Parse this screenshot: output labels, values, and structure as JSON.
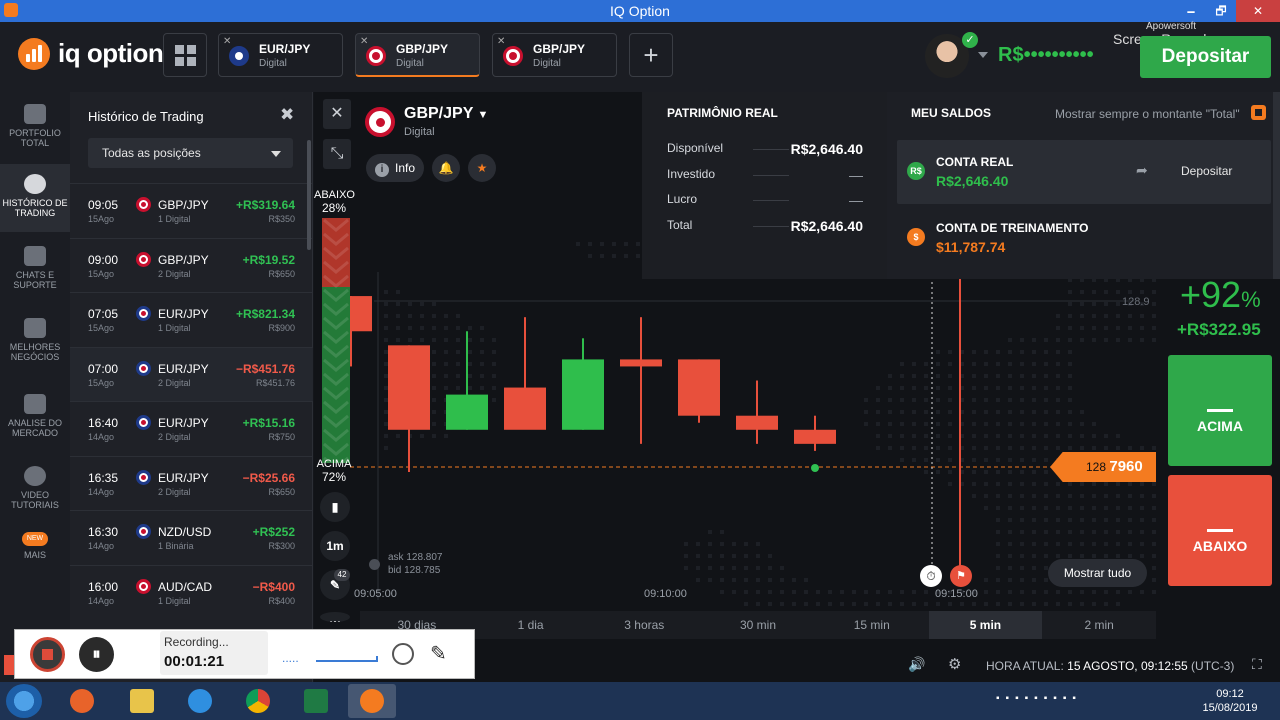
{
  "window": {
    "title": "IQ Option",
    "min": "🗕",
    "max": "🗗",
    "close": "✕"
  },
  "header": {
    "logo": "iq option",
    "tabs": [
      {
        "name": "EUR/JPY",
        "sub": "Digital"
      },
      {
        "name": "GBP/JPY",
        "sub": "Digital"
      },
      {
        "name": "GBP/JPY",
        "sub": "Digital"
      }
    ],
    "add_tab": "+",
    "balance": "R$••••••••••",
    "recorder_watermark_1": "Apowersoft",
    "recorder_watermark_2": "Screen Recorder",
    "deposit_label": "Depositar"
  },
  "sidebar": {
    "items": [
      {
        "label": "PORTFOLIO TOTAL"
      },
      {
        "label": "HISTÓRICO DE TRADING"
      },
      {
        "label": "CHATS E SUPORTE"
      },
      {
        "label": "MELHORES NEGÓCIOS"
      },
      {
        "label": "ANALISE DO MERCADO"
      },
      {
        "label": "VIDEO TUTORIAIS"
      },
      {
        "label": "MAIS",
        "badge": "NEW"
      }
    ]
  },
  "history": {
    "title": "Histórico de Trading",
    "close": "✖",
    "filter": "Todas as posições",
    "rows": [
      {
        "time": "09:05",
        "date": "15Ago",
        "pair": "GBP/JPY",
        "kind": "1 Digital",
        "amount": "+R$319.64",
        "invest": "R$350",
        "sign": "pos",
        "flag": "gb"
      },
      {
        "time": "09:00",
        "date": "15Ago",
        "pair": "GBP/JPY",
        "kind": "2 Digital",
        "amount": "+R$19.52",
        "invest": "R$650",
        "sign": "pos",
        "flag": "gb"
      },
      {
        "time": "07:05",
        "date": "15Ago",
        "pair": "EUR/JPY",
        "kind": "1 Digital",
        "amount": "+R$821.34",
        "invest": "R$900",
        "sign": "pos",
        "flag": "eu"
      },
      {
        "time": "07:00",
        "date": "15Ago",
        "pair": "EUR/JPY",
        "kind": "2 Digital",
        "amount": "−R$451.76",
        "invest": "R$451.76",
        "sign": "neg",
        "flag": "eu"
      },
      {
        "time": "16:40",
        "date": "14Ago",
        "pair": "EUR/JPY",
        "kind": "2 Digital",
        "amount": "+R$15.16",
        "invest": "R$750",
        "sign": "pos",
        "flag": "eu"
      },
      {
        "time": "16:35",
        "date": "14Ago",
        "pair": "EUR/JPY",
        "kind": "2 Digital",
        "amount": "−R$25.66",
        "invest": "R$650",
        "sign": "neg",
        "flag": "eu"
      },
      {
        "time": "16:30",
        "date": "14Ago",
        "pair": "NZD/USD",
        "kind": "1 Binária",
        "amount": "+R$252",
        "invest": "R$300",
        "sign": "pos",
        "flag": "eu"
      },
      {
        "time": "16:00",
        "date": "14Ago",
        "pair": "AUD/CAD",
        "kind": "1 Digital",
        "amount": "−R$400",
        "invest": "R$400",
        "sign": "neg",
        "flag": "gb"
      }
    ]
  },
  "chart": {
    "asset": "GBP/JPY",
    "asset_type": "Digital",
    "info": "Info",
    "sentiment_down_label": "ABAIXO",
    "sentiment_down_pct": "28%",
    "sentiment_up_label": "ACIMA",
    "sentiment_up_pct": "72%",
    "timeframe": "1m",
    "draw_badge": "42",
    "ask": "ask 128.807",
    "bid": "bid 128.785",
    "grid_price": "128.9",
    "times": [
      "09:05:00",
      "09:10:00",
      "09:15:00"
    ],
    "price_tag_small": "128",
    "price_tag_big": "7960",
    "show_all": "Mostrar tudo",
    "periods": [
      "30 dias",
      "1 dia",
      "3 horas",
      "30 min",
      "15 min",
      "5 min",
      "2 min"
    ],
    "selected_period": "5 min"
  },
  "chart_data": {
    "type": "candlestick",
    "candles": [
      {
        "o": 128.95,
        "h": 128.95,
        "l": 128.85,
        "c": 128.9,
        "dir": "down"
      },
      {
        "o": 128.88,
        "h": 128.88,
        "l": 128.7,
        "c": 128.76,
        "dir": "down"
      },
      {
        "o": 128.76,
        "h": 128.9,
        "l": 128.76,
        "c": 128.81,
        "dir": "up"
      },
      {
        "o": 128.82,
        "h": 128.92,
        "l": 128.78,
        "c": 128.76,
        "dir": "down"
      },
      {
        "o": 128.76,
        "h": 128.89,
        "l": 128.76,
        "c": 128.86,
        "dir": "up"
      },
      {
        "o": 128.86,
        "h": 128.92,
        "l": 128.74,
        "c": 128.85,
        "dir": "down"
      },
      {
        "o": 128.86,
        "h": 128.86,
        "l": 128.77,
        "c": 128.78,
        "dir": "down"
      },
      {
        "o": 128.78,
        "h": 128.83,
        "l": 128.74,
        "c": 128.76,
        "dir": "down"
      },
      {
        "o": 128.76,
        "h": 128.78,
        "l": 128.73,
        "c": 128.74,
        "dir": "down"
      }
    ]
  },
  "trade": {
    "payout": "+92",
    "payout_unit": "%",
    "profit": "+R$322.95",
    "up_label": "ACIMA",
    "down_label": "ABAIXO"
  },
  "popover": {
    "left_title": "PATRIMÔNIO REAL",
    "rows": [
      {
        "label": "Disponível",
        "value": "R$2,646.40",
        "muted": false
      },
      {
        "label": "Investido",
        "value": "—",
        "muted": true
      },
      {
        "label": "Lucro",
        "value": "—",
        "muted": true
      },
      {
        "label": "Total",
        "value": "R$2,646.40",
        "muted": false
      }
    ],
    "right_title": "MEU SALDOS",
    "always_show": "Mostrar sempre o montante \"Total\"",
    "real_account": "CONTA REAL",
    "real_balance": "R$2,646.40",
    "real_deposit": "Depositar",
    "real_badge": "R$",
    "demo_account": "CONTA DE TREINAMENTO",
    "demo_balance": "$11,787.74",
    "demo_badge": "$"
  },
  "footer": {
    "time_label": "HORA ATUAL:",
    "time_value": "15 AGOSTO, 09:12:55",
    "tz": "(UTC-3)"
  },
  "recorder": {
    "status": "Recording...",
    "elapsed": "00:01:21",
    "dots": "....."
  },
  "taskbar": {
    "time": "09:12",
    "date": "15/08/2019"
  },
  "colors": {
    "accent": "#f47b20",
    "up": "#2fbe4c",
    "down": "#e8503c"
  }
}
